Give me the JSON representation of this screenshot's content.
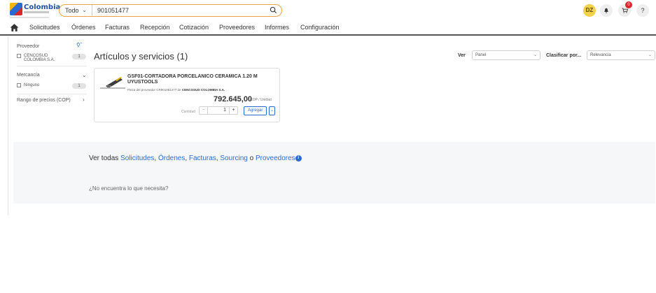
{
  "header": {
    "logo_text": "Colombia",
    "search": {
      "scope": "Todo",
      "query": "901051477"
    },
    "avatar_initials": "DZ",
    "cart_count": "0",
    "help": "?"
  },
  "nav": {
    "items": [
      "Solicitudes",
      "Órdenes",
      "Facturas",
      "Recepción",
      "Cotización",
      "Proveedores",
      "Informes",
      "Configuración"
    ]
  },
  "sidebar": {
    "supplier_heading": "Proveedor",
    "supplier_option": "CENCOSUD COLOMBIA S.A.",
    "supplier_count": "1",
    "merchandise_heading": "Mercancía",
    "merchandise_option": "Ninguno",
    "merchandise_count": "1",
    "price_range": "Rango de precios (COP)"
  },
  "main": {
    "title": "Artículos y servicios (1)",
    "view_label": "Ver",
    "view_value": "Panel",
    "sort_label": "Clasificar por...",
    "sort_value": "Relevancia"
  },
  "product": {
    "title": "GSF01-CORTADORA PORCELANICO CERAMICA 1.20 M UYUSTOOLS",
    "sub_prefix": "Pieza del proveedor CR901051477 de",
    "supplier": "CENCOSUD COLOMBIA S.A.",
    "price": "792.645,00",
    "unit": "COP / Unidad",
    "qty_label": "Cantidad",
    "qty_value": "1",
    "add_label": "Agregar"
  },
  "bottom": {
    "see_all_prefix": "Ver todas",
    "link_requests": "Solicitudes",
    "link_orders": "Órdenes",
    "link_invoices": "Facturas",
    "link_sourcing": "Sourcing",
    "link_suppliers": "Proveedores",
    "sep_comma": ",",
    "sep_or": "o",
    "not_found": "¿No encuentra lo que necesita?"
  },
  "colors": {
    "accent": "#2a6bd1",
    "search_border": "#e9a34a",
    "badge": "#d9262b",
    "avatar": "#f2d24a"
  }
}
